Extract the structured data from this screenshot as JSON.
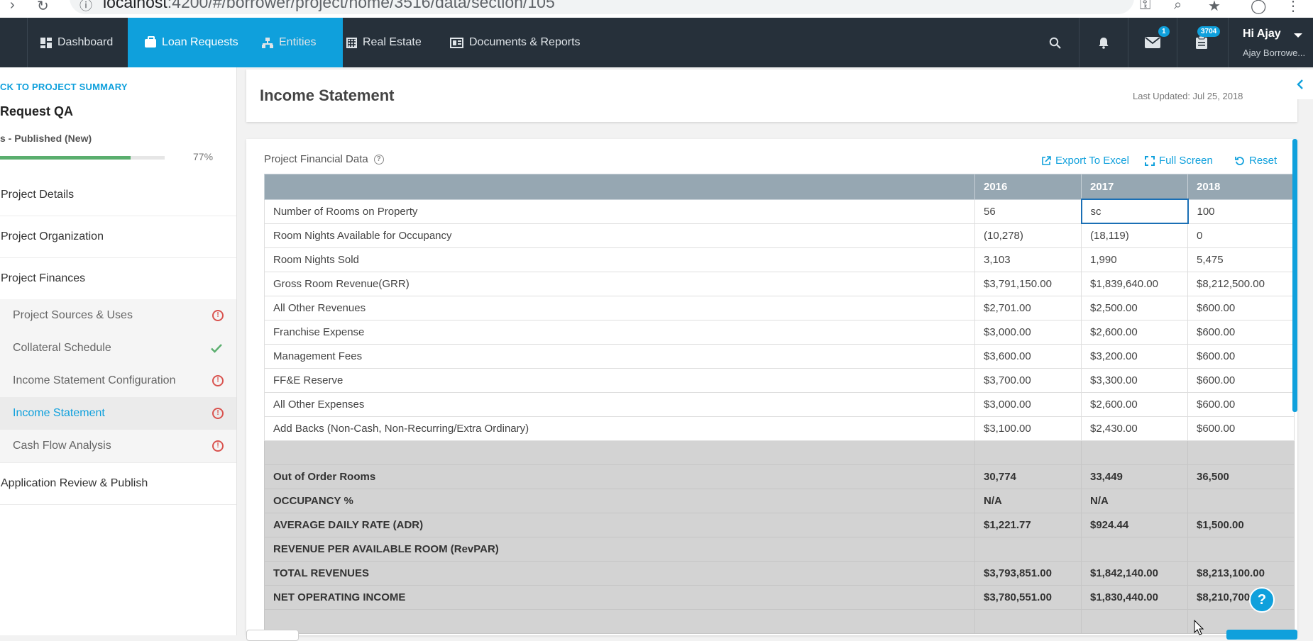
{
  "browser": {
    "url_host": "localhost",
    "url_rest": ":4200/#/borrower/project/home/3516/data/section/105"
  },
  "nav": {
    "items": [
      {
        "label": "Dashboard",
        "icon": "dashboard-icon"
      },
      {
        "label": "Loan Requests",
        "icon": "briefcase-icon",
        "active": true
      },
      {
        "label": "Entities",
        "icon": "sitemap-icon"
      },
      {
        "label": "Real Estate",
        "icon": "building-icon"
      },
      {
        "label": "Documents & Reports",
        "icon": "newspaper-icon"
      }
    ],
    "mail_badge": "1",
    "tasks_badge": "3704",
    "user_greeting": "Hi Ajay",
    "user_name": "Ajay Borrowe..."
  },
  "sidebar": {
    "back_link": "CK TO PROJECT SUMMARY",
    "project_title": "Request QA",
    "status": "s - Published (New)",
    "progress": 0.77,
    "progress_label": "77%",
    "items": [
      {
        "label": "Project Details"
      },
      {
        "label": "Project Organization"
      },
      {
        "label": "Project Finances"
      }
    ],
    "sub_items": [
      {
        "label": "Project Sources & Uses",
        "state": "warning"
      },
      {
        "label": "Collateral Schedule",
        "state": "complete"
      },
      {
        "label": "Income Statement Configuration",
        "state": "warning"
      },
      {
        "label": "Income Statement",
        "state": "warning",
        "active": true
      },
      {
        "label": "Cash Flow Analysis",
        "state": "warning"
      }
    ],
    "last_item": "Application Review & Publish"
  },
  "header": {
    "title": "Income Statement",
    "last_updated": "Last Updated: Jul 25, 2018"
  },
  "card": {
    "title": "Project Financial Data",
    "actions": {
      "export": "Export To Excel",
      "fullscreen": "Full Screen",
      "reset": "Reset"
    }
  },
  "table": {
    "headers": [
      "",
      "2016",
      "2017",
      "2018"
    ],
    "rows": [
      {
        "label": "Number of Rooms on Property",
        "values": [
          "56",
          "sc",
          "100"
        ],
        "editing_col": 1
      },
      {
        "label": "Room Nights Available for Occupancy",
        "values": [
          "(10,278)",
          "(18,119)",
          "0"
        ]
      },
      {
        "label": "Room Nights Sold",
        "values": [
          "3,103",
          "1,990",
          "5,475"
        ]
      },
      {
        "label": "Gross Room Revenue(GRR)",
        "values": [
          "$3,791,150.00",
          "$1,839,640.00",
          "$8,212,500.00"
        ]
      },
      {
        "label": "All Other Revenues",
        "values": [
          "$2,701.00",
          "$2,500.00",
          "$600.00"
        ]
      },
      {
        "label": "Franchise Expense",
        "values": [
          "$3,000.00",
          "$2,600.00",
          "$600.00"
        ]
      },
      {
        "label": "Management Fees",
        "values": [
          "$3,600.00",
          "$3,200.00",
          "$600.00"
        ]
      },
      {
        "label": "FF&E Reserve",
        "values": [
          "$3,700.00",
          "$3,300.00",
          "$600.00"
        ]
      },
      {
        "label": "All Other Expenses",
        "values": [
          "$3,000.00",
          "$2,600.00",
          "$600.00"
        ]
      },
      {
        "label": "Add Backs (Non-Cash, Non-Recurring/Extra Ordinary)",
        "values": [
          "$3,100.00",
          "$2,430.00",
          "$600.00"
        ]
      }
    ],
    "calc_rows": [
      {
        "label": "",
        "values": [
          "",
          "",
          ""
        ]
      },
      {
        "label": "Out of Order Rooms",
        "values": [
          "30,774",
          "33,449",
          "36,500"
        ]
      },
      {
        "label": "OCCUPANCY %",
        "values": [
          "N/A",
          "N/A",
          ""
        ]
      },
      {
        "label": "AVERAGE DAILY RATE (ADR)",
        "values": [
          "$1,221.77",
          "$924.44",
          "$1,500.00"
        ]
      },
      {
        "label": "REVENUE PER AVAILABLE ROOM (RevPAR)",
        "values": [
          "",
          "",
          ""
        ]
      },
      {
        "label": "TOTAL REVENUES",
        "values": [
          "$3,793,851.00",
          "$1,842,140.00",
          "$8,213,100.00"
        ]
      },
      {
        "label": "NET OPERATING INCOME",
        "values": [
          "$3,780,551.00",
          "$1,830,440.00",
          "$8,210,700.00"
        ]
      },
      {
        "label": "",
        "values": [
          "",
          "",
          ""
        ]
      }
    ]
  }
}
